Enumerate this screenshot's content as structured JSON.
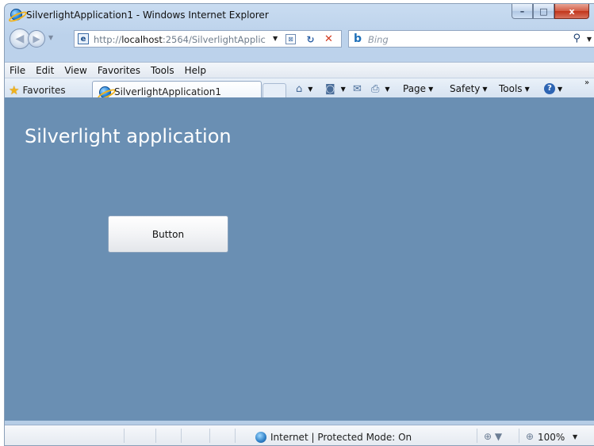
{
  "window": {
    "title": "SilverlightApplication1 - Windows Internet Explorer",
    "caption_minimize": "–",
    "caption_maximize": "□",
    "caption_close": "x"
  },
  "address_bar": {
    "url_prefix": "http://",
    "url_host": "localhost",
    "url_rest": ":2564/SilverlightApplic",
    "dropdown_icon": "▼",
    "compat_icon": "⊠",
    "refresh_icon": "↻",
    "stop_icon": "✕"
  },
  "search": {
    "logo": "b",
    "placeholder": "Bing",
    "search_icon": "⚲",
    "dropdown_icon": "▼"
  },
  "menu": {
    "items": [
      "File",
      "Edit",
      "View",
      "Favorites",
      "Tools",
      "Help"
    ]
  },
  "favorites_bar": {
    "favorites_label": "Favorites",
    "tab_label": "SilverlightApplication1",
    "home_icon": "⌂",
    "feeds_icon": "◙",
    "mail_icon": "✉",
    "print_icon": "⎙",
    "page_label": "Page",
    "safety_label": "Safety",
    "tools_label": "Tools",
    "help_icon": "?",
    "more_icon": "»"
  },
  "content": {
    "title": "Silverlight application",
    "button_label": "Button",
    "background_color": "#6a8fb3"
  },
  "status_bar": {
    "zone_text": "Internet | Protected Mode: On",
    "zoom_text": "100%",
    "protected_icon": "⊕",
    "zoom_icon": "⊕"
  }
}
